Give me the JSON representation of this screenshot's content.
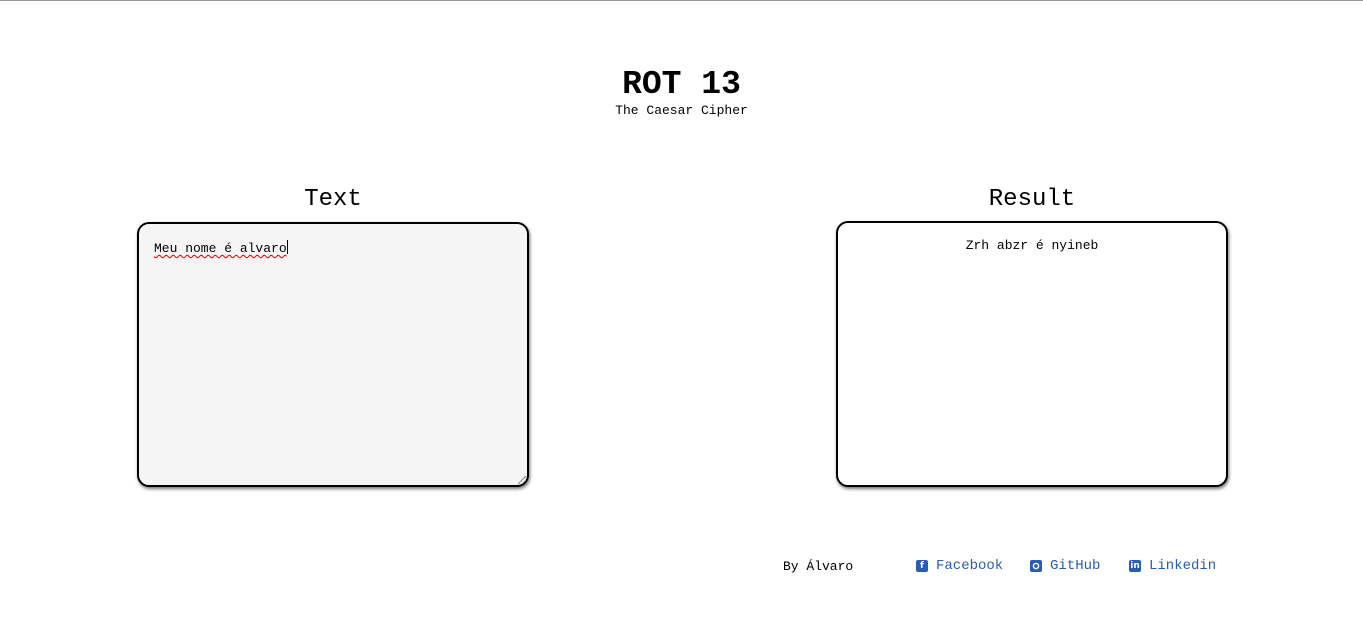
{
  "header": {
    "title": "ROT 13",
    "subtitle": "The Caesar Cipher"
  },
  "input_panel": {
    "label": "Text",
    "value": "Meu nome é alvaro"
  },
  "result_panel": {
    "label": "Result",
    "value": "Zrh abzr é nyineb"
  },
  "footer": {
    "byline": "By Álvaro",
    "links": [
      {
        "label": "Facebook",
        "icon": "facebook-icon"
      },
      {
        "label": "GitHub",
        "icon": "github-icon"
      },
      {
        "label": "Linkedin",
        "icon": "linkedin-icon"
      }
    ]
  },
  "colors": {
    "link": "#2a5db0",
    "input_background": "#f5f5f5",
    "border": "#000000"
  }
}
